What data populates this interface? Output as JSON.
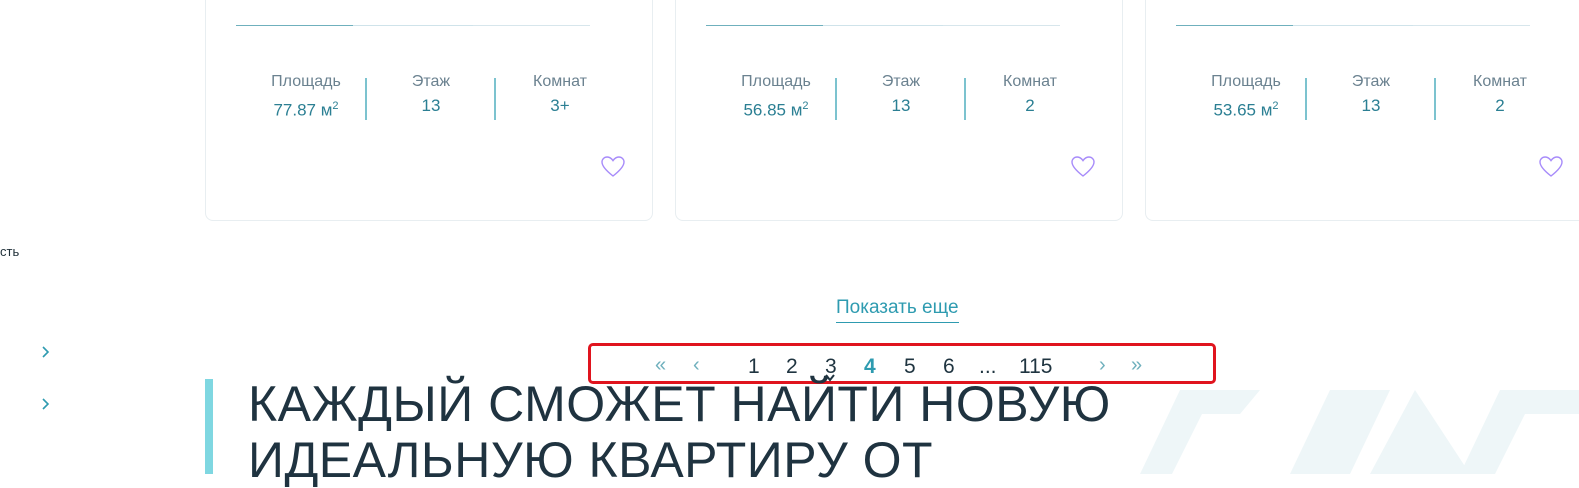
{
  "sidebar": {
    "partial_text": "сть"
  },
  "cards": [
    {
      "stats": [
        {
          "label": "Площадь",
          "value": "77.87 м",
          "unit_sup": "2"
        },
        {
          "label": "Этаж",
          "value": "13"
        },
        {
          "label": "Комнат",
          "value": "3+"
        }
      ],
      "favorite_icon": "heart-icon"
    },
    {
      "stats": [
        {
          "label": "Площадь",
          "value": "56.85 м",
          "unit_sup": "2"
        },
        {
          "label": "Этаж",
          "value": "13"
        },
        {
          "label": "Комнат",
          "value": "2"
        }
      ],
      "favorite_icon": "heart-icon"
    },
    {
      "stats": [
        {
          "label": "Площадь",
          "value": "53.65 м",
          "unit_sup": "2"
        },
        {
          "label": "Этаж",
          "value": "13"
        },
        {
          "label": "Комнат",
          "value": "2"
        }
      ],
      "favorite_icon": "heart-icon"
    }
  ],
  "show_more": {
    "label": "Показать еще"
  },
  "pagination": {
    "first": "«",
    "prev": "‹",
    "pages": [
      "1",
      "2",
      "3",
      "4",
      "5",
      "6",
      "...",
      "115"
    ],
    "active_page": "4",
    "next": "›",
    "last": "»"
  },
  "headline": {
    "line1": "КАЖДЫЙ СМОЖЕТ НАЙТИ НОВУЮ",
    "line2": "ИДЕАЛЬНУЮ КВАРТИРУ ОТ"
  },
  "colors": {
    "accent": "#2e9bb0",
    "heading": "#1f3340",
    "highlight_border": "#e0141e",
    "heart": "#a78bfa"
  }
}
